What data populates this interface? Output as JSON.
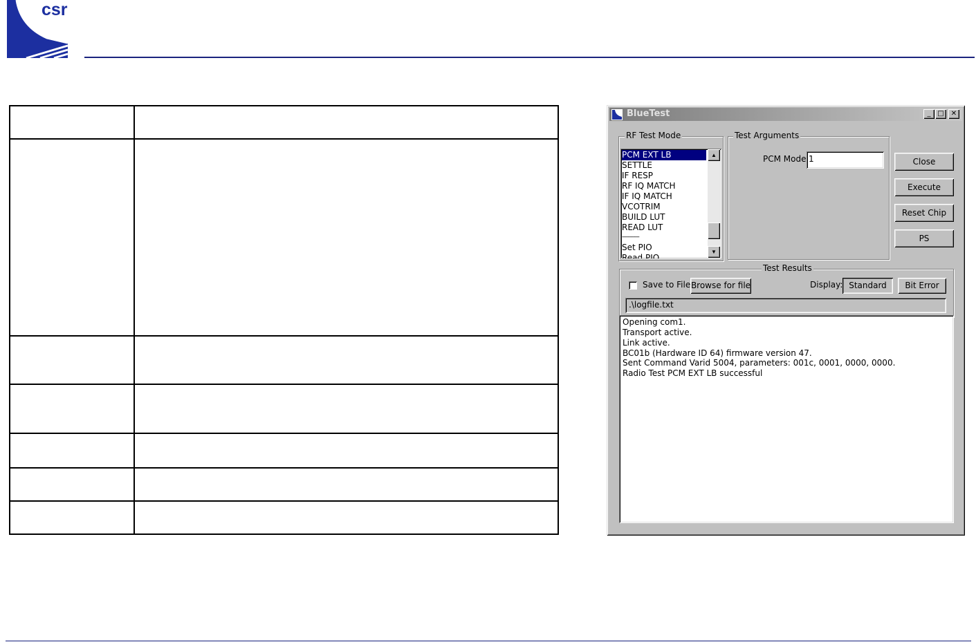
{
  "brand": {
    "logo_text": "csr",
    "accent": "#1c2fa0",
    "rule": "#1a237e"
  },
  "window": {
    "title": "BlueTest",
    "controls": {
      "minimize": "_",
      "maximize": "□",
      "close": "✕"
    },
    "rf_test_mode": {
      "label": "RF Test Mode",
      "items": [
        "PCM EXT LB",
        "SETTLE",
        "IF RESP",
        "RF IQ MATCH",
        "IF IQ MATCH",
        "VCOTRIM",
        "BUILD LUT",
        "READ LUT",
        "-----------",
        "Set PIO",
        "Read PIO"
      ],
      "selected": "PCM EXT LB"
    },
    "test_arguments": {
      "label": "Test Arguments",
      "pcm_mode_label": "PCM Mode",
      "pcm_mode_value": "1"
    },
    "buttons": {
      "close": "Close",
      "execute": "Execute",
      "reset_chip": "Reset Chip",
      "ps": "PS"
    },
    "test_results": {
      "label": "Test Results",
      "save_to_file_label": "Save to File",
      "save_to_file_checked": false,
      "browse_label": "Browse for file",
      "display_label": "Display:",
      "display_standard": "Standard",
      "display_bit_error": "Bit Error",
      "file_path": ".\\logfile.txt",
      "log": [
        "Opening com1.",
        "Transport active.",
        "Link active.",
        "BC01b (Hardware ID 64) firmware version 47.",
        "Sent Command Varid 5004, parameters: 001c, 0001, 0000, 0000.",
        "Radio Test PCM EXT LB successful"
      ]
    }
  }
}
